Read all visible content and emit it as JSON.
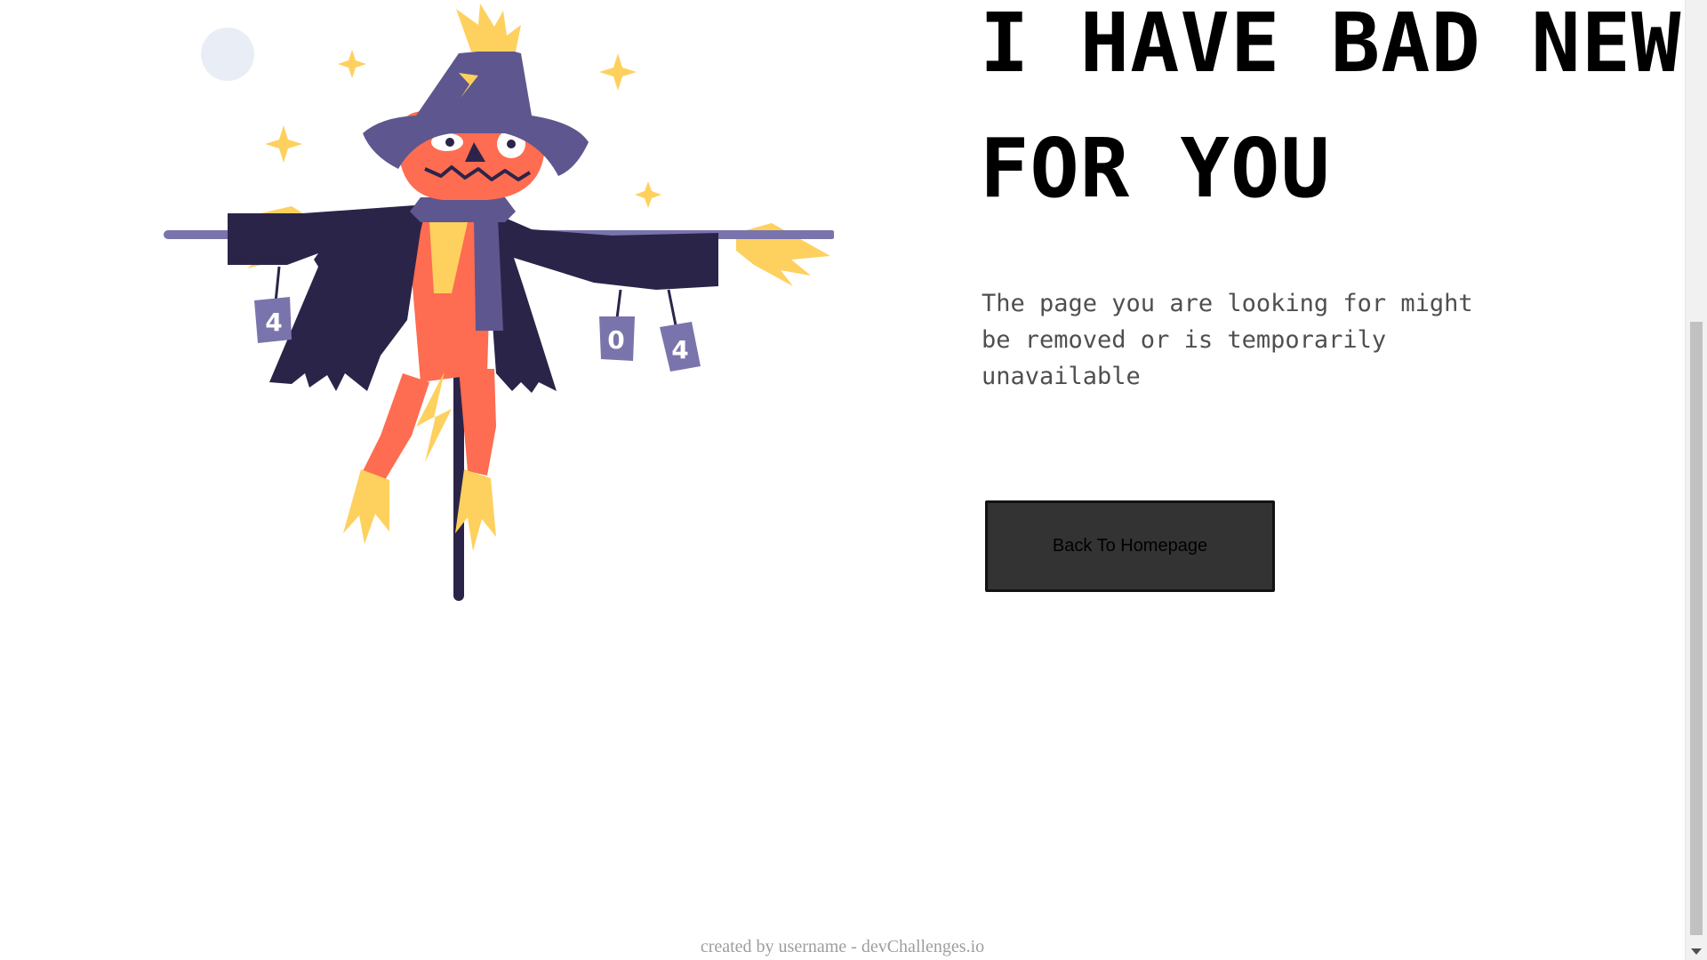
{
  "headline": {
    "line1": "I HAVE BAD NEWS",
    "line2": "FOR YOU"
  },
  "description": "The page you are looking for might be removed or is temporarily unavailable",
  "button": {
    "label": "Back To Homepage"
  },
  "illustration": {
    "icon": "scarecrow-404-illustration",
    "cans": [
      "4",
      "0",
      "4"
    ]
  },
  "footer": {
    "text": "created by username - devChallenges.io"
  },
  "colors": {
    "text": "#000000",
    "body_text": "#4f4f4f",
    "button_bg": "#333333",
    "footer_text": "#9e9e9e",
    "coat": "#2b2449",
    "hat": "#5e568e",
    "face": "#fe6c51",
    "straw": "#fed05e",
    "can": "#7a74ac",
    "moon": "#e9edf5"
  }
}
